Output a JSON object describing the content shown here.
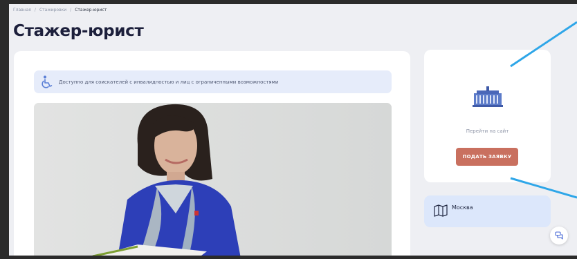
{
  "breadcrumb": {
    "items": [
      "Главная",
      "Стажировки"
    ],
    "separator": "/",
    "current": "Стажер-юрист"
  },
  "page": {
    "title": "Стажер-юрист"
  },
  "accessibility_banner": {
    "icon": "wheelchair-icon",
    "text": "Доступно для соискателей с инвалидностью и лиц с ограниченными возможностями"
  },
  "photo": {
    "alt": "Портрет сотрудницы"
  },
  "side_card": {
    "logo_icon": "government-building-icon",
    "site_link": "Перейти на сайт",
    "apply_button": "ПОДАТЬ ЗАЯВКУ"
  },
  "location": {
    "icon": "map-icon",
    "city": "Москва"
  },
  "chat": {
    "icon": "chat-icon"
  },
  "colors": {
    "background": "#eeeff3",
    "title": "#1c1f3b",
    "banner": "#e6ecfa",
    "apply_button": "#c9705f",
    "location_card": "#dce7fb",
    "annotation_line": "#2ea6e8"
  }
}
